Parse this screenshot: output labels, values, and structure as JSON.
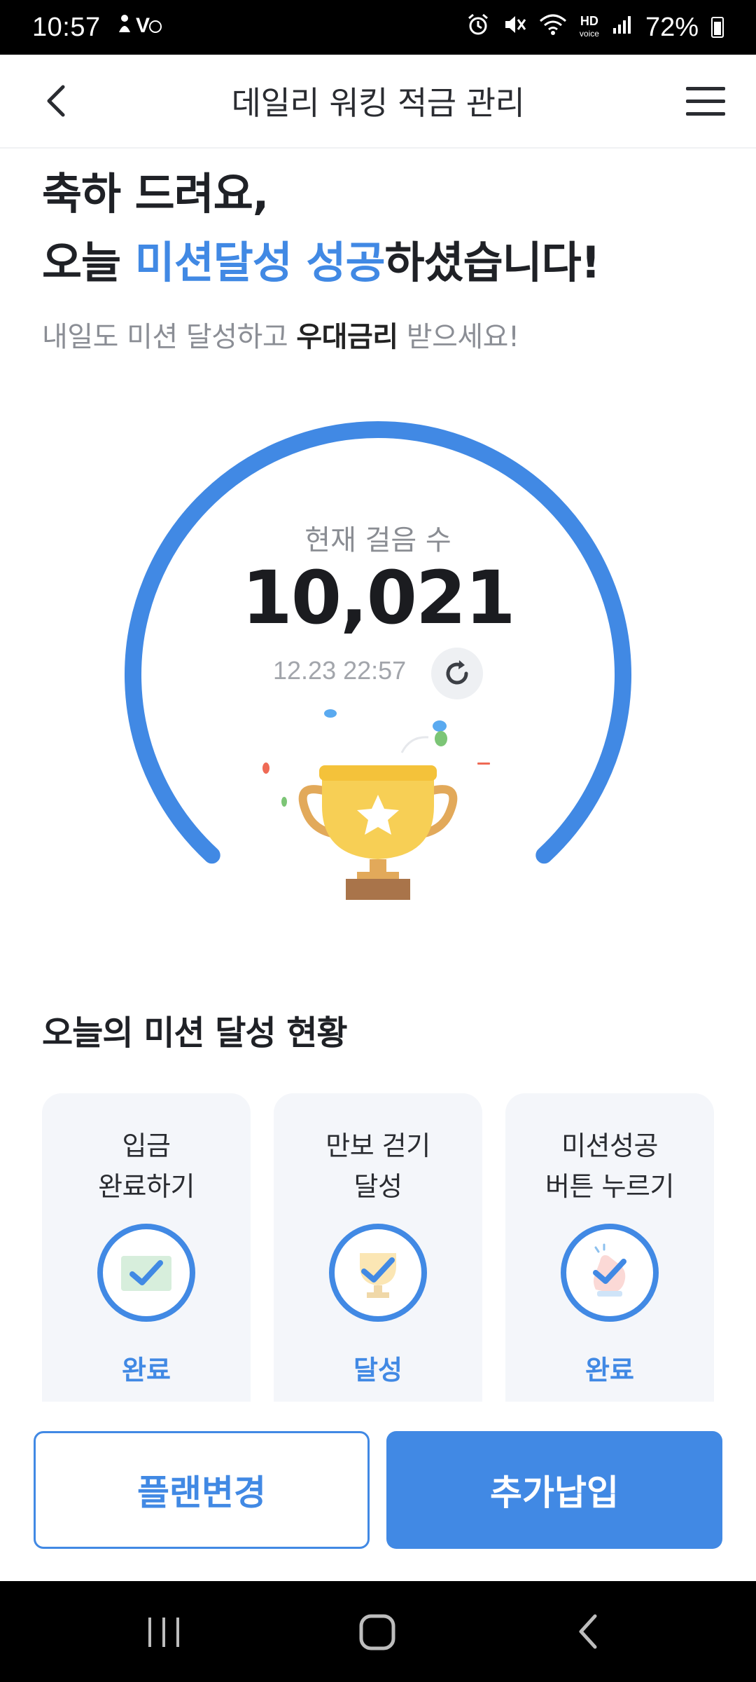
{
  "status_bar": {
    "time": "10:57",
    "hd_top": "HD",
    "hd_bottom": "voice",
    "battery": "72%"
  },
  "header": {
    "title": "데일리 워킹 적금 관리"
  },
  "headline": {
    "line1": "축하 드려요,",
    "line2_prefix": "오늘 ",
    "line2_accent": "미션달성 성공",
    "line2_suffix": "하셨습니다!"
  },
  "subtitle": {
    "prefix": "내일도 미션 달성하고 ",
    "bold": "우대금리",
    "suffix": " 받으세요!"
  },
  "steps": {
    "label": "현재 걸음 수",
    "value": "10,021",
    "updated_at": "12.23 22:57",
    "progress": 1.0
  },
  "mission_section": {
    "title": "오늘의 미션 달성 현황",
    "cards": [
      {
        "label": "입금\n완료하기",
        "status": "완료",
        "icon": "deposit-check-icon"
      },
      {
        "label": "만보 걷기\n달성",
        "status": "달성",
        "icon": "trophy-check-icon"
      },
      {
        "label": "미션성공\n버튼 누르기",
        "status": "완료",
        "icon": "tap-check-icon"
      }
    ]
  },
  "buttons": {
    "change_plan": "플랜변경",
    "extra_deposit": "추가납입"
  },
  "colors": {
    "accent": "#4189e4",
    "trophy_gold": "#f7cf55",
    "trophy_base": "#a9744a"
  }
}
